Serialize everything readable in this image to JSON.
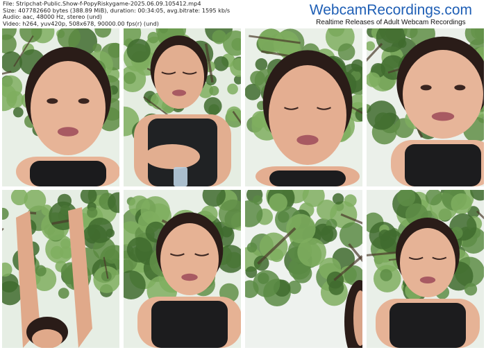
{
  "file_info": {
    "file": "File: Stripchat-Public.Show-f-PopyRiskygame-2025.06.09.105412.mp4",
    "size": "Size: 407782660 bytes (388.89 MiB), duration: 00:34:05, avg.bitrate: 1595 kb/s",
    "audio": "Audio: aac, 48000 Hz, stereo (und)",
    "video": "Video: h264, yuv420p, 508x678, 90000.00 fps(r) (und)"
  },
  "brand": {
    "name": "WebcamRecordings.com",
    "tagline": "Realtime Releases of Adult Webcam Recordings"
  },
  "thumbnails": [
    {
      "id": 1,
      "scene": "face-closeup",
      "colors": {
        "foliage": "#5e8c43",
        "sky": "#e8efe6",
        "skin": "#e7b497",
        "hair": "#2a1c18",
        "top": "#1b1b1d"
      }
    },
    {
      "id": 2,
      "scene": "holding-bottle",
      "colors": {
        "foliage": "#6a9a4c",
        "sky": "#e5ede2",
        "skin": "#e2ae90",
        "hair": "#2b1d18",
        "top": "#202224"
      }
    },
    {
      "id": 3,
      "scene": "face-closeup",
      "colors": {
        "foliage": "#5f8d46",
        "sky": "#eaf0e8",
        "skin": "#e4ae91",
        "hair": "#2a1c18",
        "top": "#1c1c1e"
      }
    },
    {
      "id": 4,
      "scene": "face-closeup",
      "colors": {
        "foliage": "#608e47",
        "sky": "#ebf0ea",
        "skin": "#e7b599",
        "hair": "#2a1c18",
        "top": "#1c1c1e"
      }
    },
    {
      "id": 5,
      "scene": "arms-raised",
      "colors": {
        "foliage": "#5a8a42",
        "sky": "#e6eee4",
        "skin": "#e0a98a",
        "hair": "#2a1c18",
        "top": "#1c1c1e"
      }
    },
    {
      "id": 6,
      "scene": "face-closeup",
      "colors": {
        "foliage": "#628f48",
        "sky": "#e8efe6",
        "skin": "#e6b294",
        "hair": "#2a1c18",
        "top": "#1c1c1e"
      }
    },
    {
      "id": 7,
      "scene": "tree-branches",
      "colors": {
        "foliage": "#5b8b44",
        "sky": "#eef2ee",
        "skin": "#d9a488",
        "hair": "#2a1c18",
        "top": "#1c1c1e"
      }
    },
    {
      "id": 8,
      "scene": "face-closeup",
      "colors": {
        "foliage": "#5e8d46",
        "sky": "#e9efe8",
        "skin": "#e6b396",
        "hair": "#2a1c18",
        "top": "#1c1c1e"
      }
    }
  ]
}
